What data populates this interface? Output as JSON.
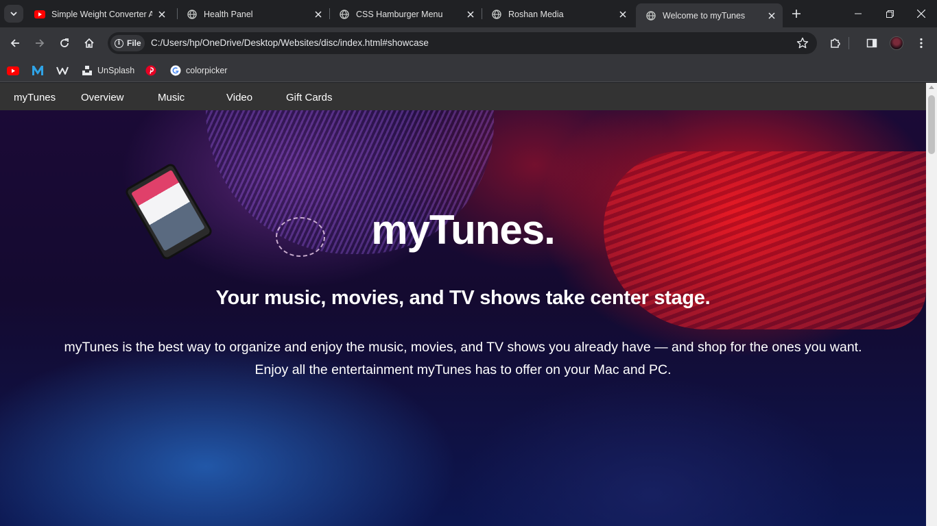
{
  "browser": {
    "tabs": [
      {
        "title": "Simple Weight Converter App",
        "favicon": "youtube-icon",
        "active": false
      },
      {
        "title": "Health Panel",
        "favicon": "globe-icon",
        "active": false
      },
      {
        "title": "CSS Hamburger Menu",
        "favicon": "globe-icon",
        "active": false
      },
      {
        "title": "Roshan Media",
        "favicon": "globe-icon",
        "active": false
      },
      {
        "title": "Welcome to myTunes",
        "favicon": "globe-icon",
        "active": true
      }
    ],
    "address": {
      "chip_label": "File",
      "url": "C:/Users/hp/OneDrive/Desktop/Websites/disc/index.html#showcase"
    },
    "bookmarks": [
      {
        "label": "",
        "icon": "youtube-icon"
      },
      {
        "label": "",
        "icon": "m-logo-icon"
      },
      {
        "label": "",
        "icon": "webflow-icon"
      },
      {
        "label": "UnSplash",
        "icon": "unsplash-icon"
      },
      {
        "label": "",
        "icon": "pinterest-icon"
      },
      {
        "label": "colorpicker",
        "icon": "google-icon"
      }
    ],
    "colors": {
      "frame": "#202124",
      "toolbar": "#35363a",
      "accent_red": "#ff0000"
    }
  },
  "site": {
    "nav": {
      "brand": "myTunes",
      "links": [
        "Overview",
        "Music",
        "Video",
        "Gift Cards"
      ]
    },
    "showcase": {
      "title": "myTunes.",
      "subtitle": "Your music, movies, and TV shows take center stage.",
      "description_line1": "myTunes is the best way to organize and enjoy the music, movies, and TV shows you already have — and shop for the ones you want.",
      "description_line2": "Enjoy all the entertainment myTunes has to offer on your Mac and PC."
    }
  }
}
